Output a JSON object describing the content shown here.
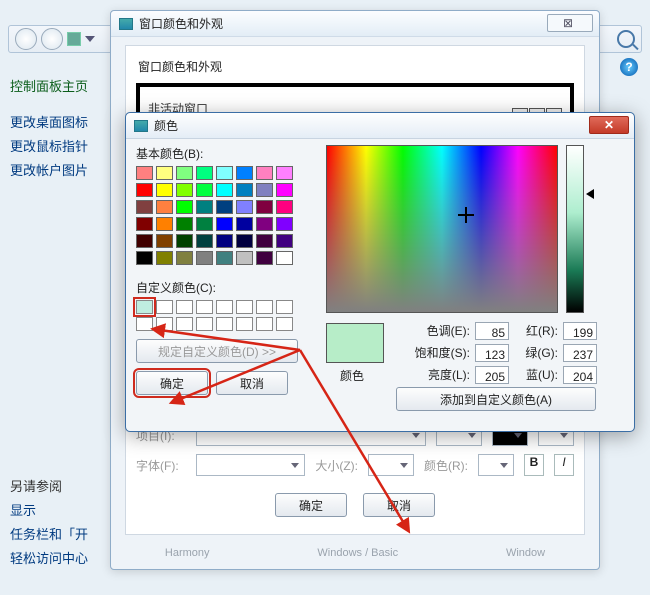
{
  "sidebar": {
    "cp_home": "控制面板主页",
    "links": [
      "更改桌面图标",
      "更改鼠标指针",
      "更改帐户图片"
    ],
    "see_also": "另请参阅",
    "see_links": [
      "显示",
      "任务栏和「开",
      "轻松访问中心"
    ]
  },
  "dlg1": {
    "title": "窗口颜色和外观",
    "section_label": "窗口颜色和外观",
    "inactive_caption": "非活动窗口",
    "item_label": "项目(I):",
    "font_label": "字体(F):",
    "size_label": "大小(Z):",
    "color_label": "颜色(R):",
    "ok": "确定",
    "cancel": "取消",
    "themes": [
      "Harmony",
      "Windows / Basic",
      "Window"
    ]
  },
  "dlg2": {
    "title": "颜色",
    "basic_label": "基本颜色(B):",
    "custom_label": "自定义颜色(C):",
    "define": "规定自定义颜色(D) >>",
    "ok": "确定",
    "cancel": "取消",
    "color_label": "颜色",
    "hue_l": "色调(E):",
    "hue_v": "85",
    "sat_l": "饱和度(S):",
    "sat_v": "123",
    "lum_l": "亮度(L):",
    "lum_v": "205",
    "red_l": "红(R):",
    "red_v": "199",
    "grn_l": "绿(G):",
    "grn_v": "237",
    "blu_l": "蓝(U):",
    "blu_v": "204",
    "add": "添加到自定义颜色(A)",
    "basic_colors": [
      "#ff8080",
      "#ffff80",
      "#80ff80",
      "#00ff80",
      "#80ffff",
      "#0080ff",
      "#ff80c0",
      "#ff80ff",
      "#ff0000",
      "#ffff00",
      "#80ff00",
      "#00ff40",
      "#00ffff",
      "#0080c0",
      "#8080c0",
      "#ff00ff",
      "#804040",
      "#ff8040",
      "#00ff00",
      "#008080",
      "#004080",
      "#8080ff",
      "#800040",
      "#ff0080",
      "#800000",
      "#ff8000",
      "#008000",
      "#008040",
      "#0000ff",
      "#0000a0",
      "#800080",
      "#8000ff",
      "#400000",
      "#804000",
      "#004000",
      "#004040",
      "#000080",
      "#000040",
      "#400040",
      "#400080",
      "#000000",
      "#808000",
      "#808040",
      "#808080",
      "#408080",
      "#c0c0c0",
      "#400040",
      "#ffffff"
    ],
    "selected_preview": "#b7edc8"
  }
}
